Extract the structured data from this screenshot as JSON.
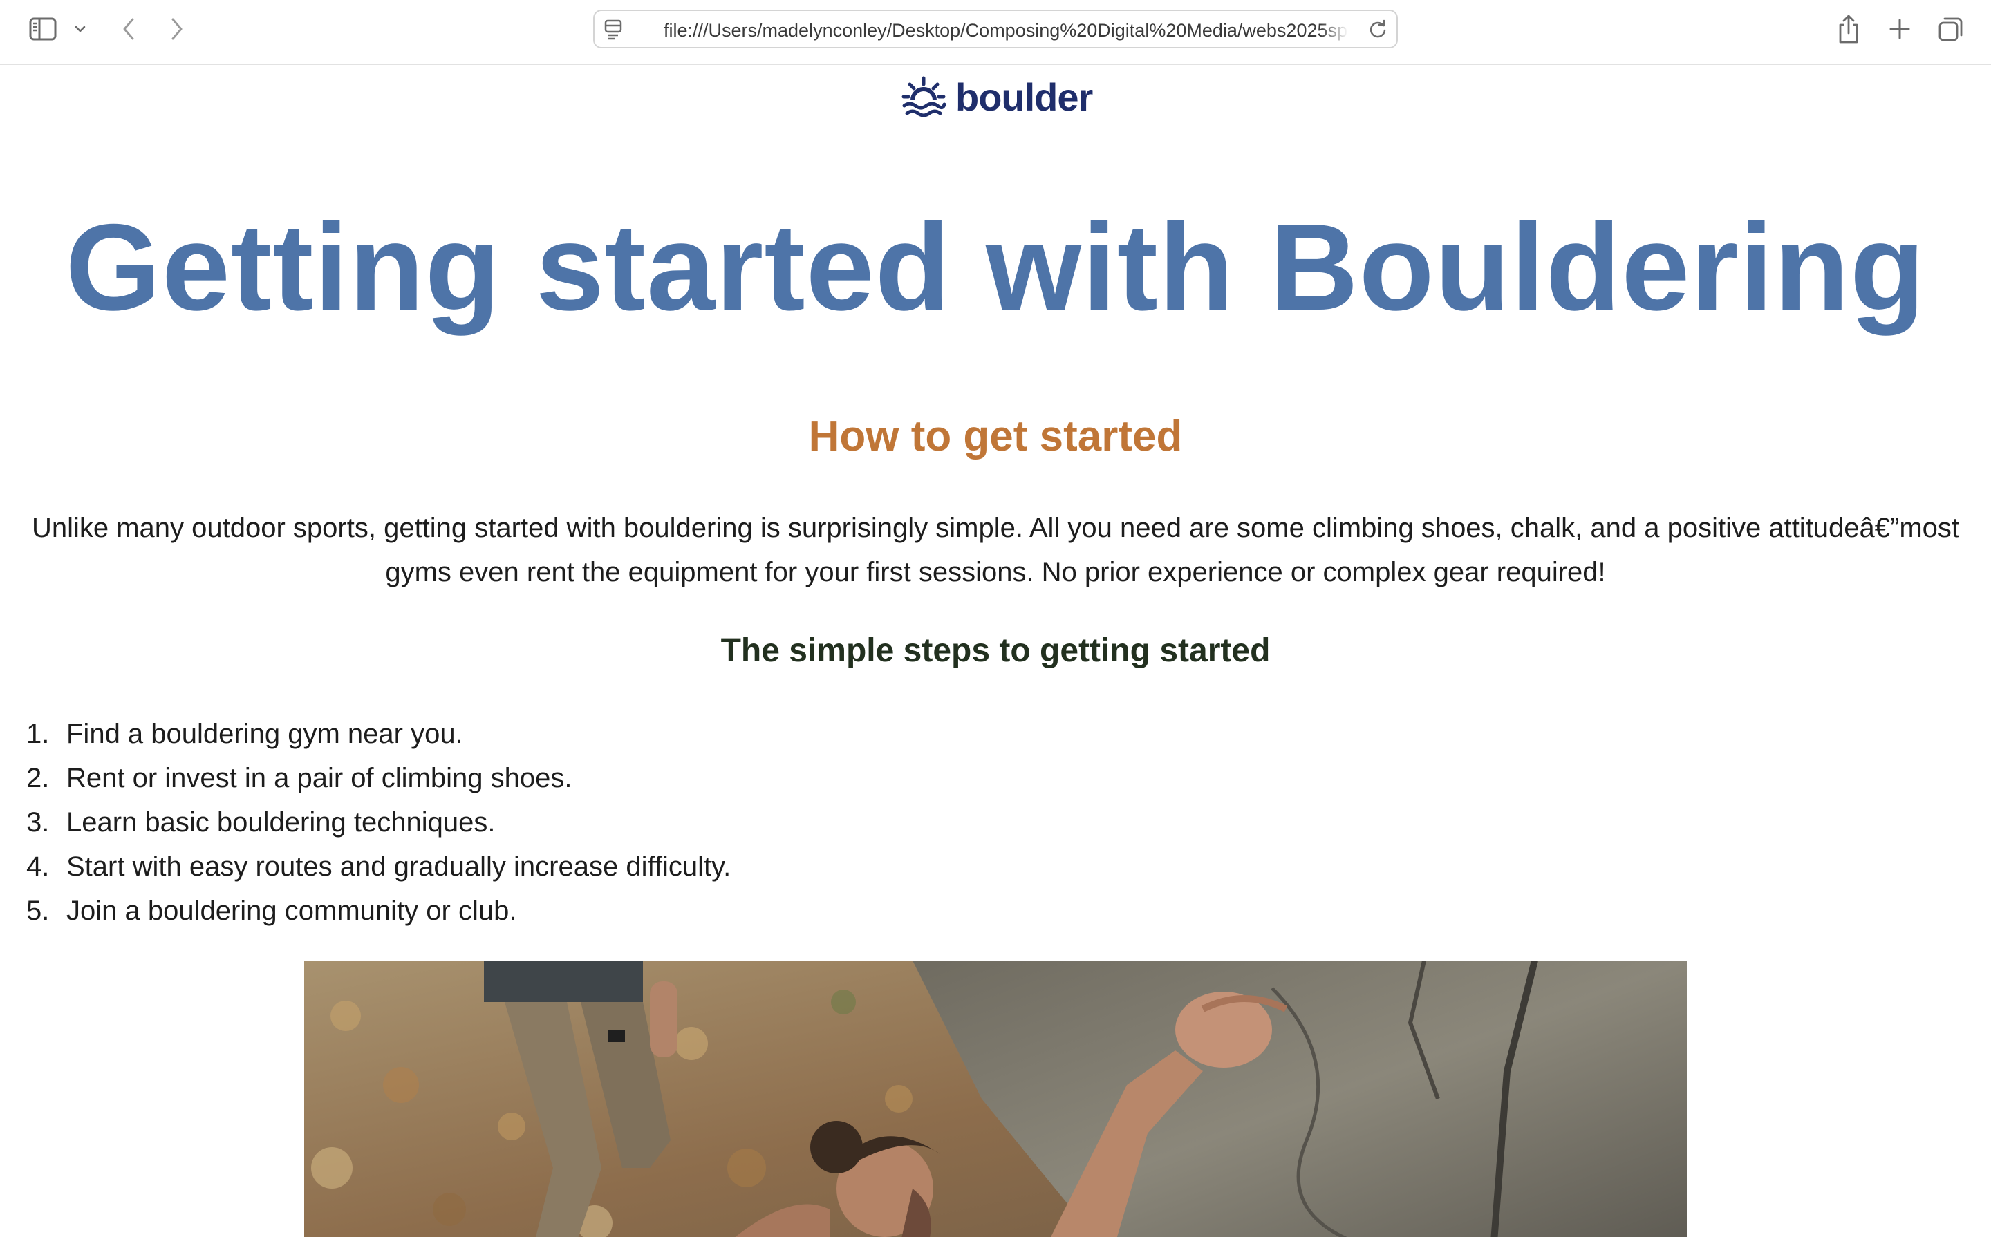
{
  "browser": {
    "url": "file:///Users/madelynconley/Desktop/Composing%20Digital%20Media/webs2025sp",
    "icons": [
      "sidebar-icon",
      "chevron-down-icon",
      "back-arrow-icon",
      "forward-arrow-icon",
      "page-icon",
      "reload-icon",
      "share-icon",
      "plus-icon",
      "tabs-overview-icon"
    ]
  },
  "page": {
    "logo_text": "boulder",
    "hero_title": "Getting started with Bouldering",
    "section_title": "How to get started",
    "intro_line1": "Unlike many outdoor sports, getting started with bouldering is surprisingly simple. All you need are some climbing shoes, chalk, and a positive attitudeâ€”most",
    "intro_line2": "gyms even rent the equipment for your first sessions. No prior experience or complex gear required!",
    "steps_title": "The simple steps to getting started",
    "steps": [
      {
        "num": "1.",
        "text": "Find a bouldering gym near you."
      },
      {
        "num": "2.",
        "text": "Rent or invest in a pair of climbing shoes."
      },
      {
        "num": "3.",
        "text": "Learn basic bouldering techniques."
      },
      {
        "num": "4.",
        "text": "Start with easy routes and gradually increase difficulty."
      },
      {
        "num": "5.",
        "text": "Join a bouldering community or club."
      }
    ]
  },
  "colors": {
    "hero_title": "#4e74a8",
    "section_title": "#c07637",
    "logo": "#1f2e6b",
    "steps_title": "#22301f",
    "body_text": "#1d1d1d"
  }
}
